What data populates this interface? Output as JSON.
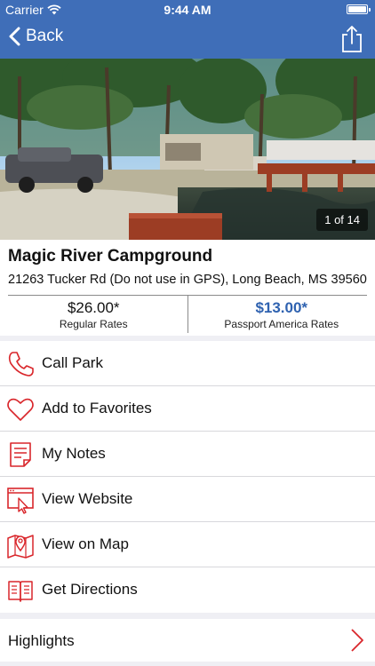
{
  "status_bar": {
    "carrier": "Carrier",
    "time": "9:44 AM",
    "battery_level": 1.0
  },
  "nav": {
    "back_label": "Back",
    "back_icon": "chevron-left-icon",
    "share_icon": "share-icon",
    "bar_color": "#3f6eb8"
  },
  "photo": {
    "counter": "1 of 14"
  },
  "park": {
    "name": "Magic River Campground",
    "address": "21263 Tucker Rd (Do not use in GPS), Long Beach, MS 39560"
  },
  "rates": {
    "regular_price": "$26.00*",
    "regular_label": "Regular Rates",
    "passport_price": "$13.00*",
    "passport_label": "Passport America Rates",
    "passport_color": "#2f62b0"
  },
  "actions": [
    {
      "label": "Call Park",
      "icon": "phone-icon"
    },
    {
      "label": "Add to Favorites",
      "icon": "heart-icon"
    },
    {
      "label": "My Notes",
      "icon": "notes-icon"
    },
    {
      "label": "View Website",
      "icon": "website-icon"
    },
    {
      "label": "View on Map",
      "icon": "map-pin-icon"
    },
    {
      "label": "Get Directions",
      "icon": "directions-icon"
    }
  ],
  "highlights": {
    "label": "Highlights",
    "icon": "chevron-right-icon"
  },
  "icon_color": "#d9262b"
}
